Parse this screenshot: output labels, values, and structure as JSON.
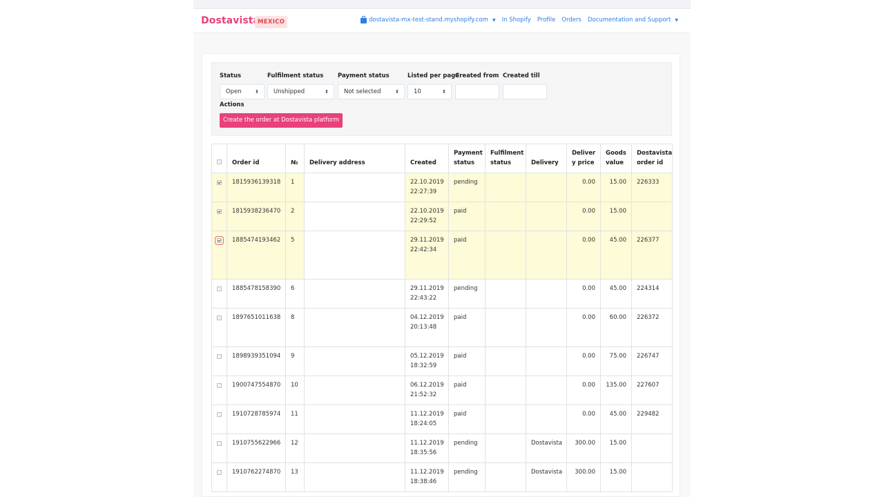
{
  "brand": {
    "name": "Dostavista",
    "region_badge": "MEXICO",
    "accent_color": "#e8417c"
  },
  "nav": {
    "store_icon": "shopping-bag-icon",
    "store": "dostavista-mx-test-stand.myshopify.com",
    "links": [
      "In Shopify",
      "Profile",
      "Orders",
      "Documentation and Support"
    ],
    "link_color": "#2f7de1"
  },
  "filters": {
    "status": {
      "label": "Status",
      "value": "Open"
    },
    "fulfilment_status": {
      "label": "Fulfilment status",
      "value": "Unshipped"
    },
    "payment_status": {
      "label": "Payment status",
      "value": "Not selected"
    },
    "listed_per_page": {
      "label": "Listed per page",
      "value": "10"
    },
    "created_from": {
      "label": "Created from",
      "value": ""
    },
    "created_till": {
      "label": "Created till",
      "value": ""
    },
    "actions_label": "Actions",
    "create_button": "Create the order at Dostavista platform"
  },
  "table": {
    "headers": [
      "Order id",
      "№",
      "Delivery address",
      "Created",
      "Payment status",
      "Fulfilment status",
      "Delivery",
      "Deliver y price",
      "Goods value",
      "Dostavista order id"
    ],
    "header_lines": {
      "payment_status": [
        "Payment",
        "status"
      ],
      "fulfilment_status": [
        "Fulfilment",
        "status"
      ],
      "delivery_price": [
        "Deliver",
        "y price"
      ],
      "goods_value": [
        "Goods",
        "value"
      ],
      "dostavista_order_id": [
        "Dostavista",
        "order id"
      ]
    },
    "rows": [
      {
        "checked": true,
        "order_id": "1815936139318",
        "no": "1",
        "address": "",
        "created_date": "22.10.2019",
        "created_time": "22:27:39",
        "payment": "pending",
        "fulfilment": "",
        "delivery": "",
        "delivery_price": "0.00",
        "goods_value": "15.00",
        "dv_order_id": "226333"
      },
      {
        "checked": true,
        "order_id": "1815938236470",
        "no": "2",
        "address": "",
        "created_date": "22.10.2019",
        "created_time": "22:29:52",
        "payment": "paid",
        "fulfilment": "",
        "delivery": "",
        "delivery_price": "0.00",
        "goods_value": "15.00",
        "dv_order_id": ""
      },
      {
        "checked": true,
        "order_id": "1885474193462",
        "no": "5",
        "address": "",
        "created_date": "29.11.2019",
        "created_time": "22:42:34",
        "payment": "paid",
        "fulfilment": "",
        "delivery": "",
        "delivery_price": "0.00",
        "goods_value": "45.00",
        "dv_order_id": "226377"
      },
      {
        "checked": false,
        "order_id": "1885478158390",
        "no": "6",
        "address": "",
        "created_date": "29.11.2019",
        "created_time": "22:43:22",
        "payment": "pending",
        "fulfilment": "",
        "delivery": "",
        "delivery_price": "0.00",
        "goods_value": "45.00",
        "dv_order_id": "224314"
      },
      {
        "checked": false,
        "order_id": "1897651011638",
        "no": "8",
        "address": "",
        "created_date": "04.12.2019",
        "created_time": "20:13:48",
        "payment": "paid",
        "fulfilment": "",
        "delivery": "",
        "delivery_price": "0.00",
        "goods_value": "60.00",
        "dv_order_id": "226372"
      },
      {
        "checked": false,
        "order_id": "1898939351094",
        "no": "9",
        "address": "",
        "created_date": "05.12.2019",
        "created_time": "18:32:59",
        "payment": "paid",
        "fulfilment": "",
        "delivery": "",
        "delivery_price": "0.00",
        "goods_value": "75.00",
        "dv_order_id": "226747"
      },
      {
        "checked": false,
        "order_id": "1900747554870",
        "no": "10",
        "address": "",
        "created_date": "06.12.2019",
        "created_time": "21:52:32",
        "payment": "paid",
        "fulfilment": "",
        "delivery": "",
        "delivery_price": "0.00",
        "goods_value": "135.00",
        "dv_order_id": "227607"
      },
      {
        "checked": false,
        "order_id": "1910728785974",
        "no": "11",
        "address": "",
        "created_date": "11.12.2019",
        "created_time": "18:24:05",
        "payment": "paid",
        "fulfilment": "",
        "delivery": "",
        "delivery_price": "0.00",
        "goods_value": "45.00",
        "dv_order_id": "229482"
      },
      {
        "checked": false,
        "order_id": "1910755622966",
        "no": "12",
        "address": "",
        "created_date": "11.12.2019",
        "created_time": "18:35:56",
        "payment": "pending",
        "fulfilment": "",
        "delivery": "Dostavista",
        "delivery_price": "300.00",
        "goods_value": "15.00",
        "dv_order_id": ""
      },
      {
        "checked": false,
        "order_id": "1910762274870",
        "no": "13",
        "address": "",
        "created_date": "11.12.2019",
        "created_time": "18:38:46",
        "payment": "pending",
        "fulfilment": "",
        "delivery": "Dostavista",
        "delivery_price": "300.00",
        "goods_value": "15.00",
        "dv_order_id": ""
      }
    ],
    "selected_row_color": "#fdfbd8"
  }
}
